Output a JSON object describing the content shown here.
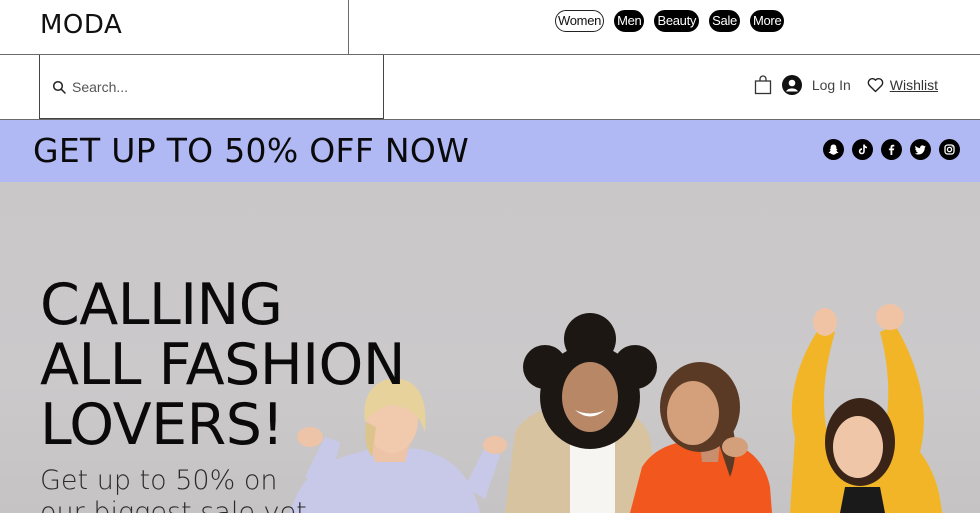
{
  "header": {
    "logo": "MODA",
    "nav": [
      {
        "label": "Women",
        "active": true
      },
      {
        "label": "Men",
        "active": false
      },
      {
        "label": "Beauty",
        "active": false
      },
      {
        "label": "Sale",
        "active": false
      },
      {
        "label": "More",
        "active": false
      }
    ]
  },
  "subbar": {
    "search_placeholder": "Search...",
    "cart_icon": "shopping-bag-icon",
    "user_icon": "user-avatar-icon",
    "login_label": "Log In",
    "heart_icon": "heart-icon",
    "wishlist_label": "Wishlist"
  },
  "promo": {
    "text": "GET UP TO 50% OFF NOW",
    "background": "#b1b9f5",
    "socials": [
      "snapchat-icon",
      "tiktok-icon",
      "facebook-icon",
      "twitter-icon",
      "instagram-icon"
    ]
  },
  "hero": {
    "title_lines": [
      "CALLING",
      "ALL FASHION",
      "LOVERS!"
    ],
    "sub_lines": [
      "Get up to 50% on",
      "our biggest sale yet"
    ],
    "image": "group of four smiling women in colorful clothing"
  }
}
